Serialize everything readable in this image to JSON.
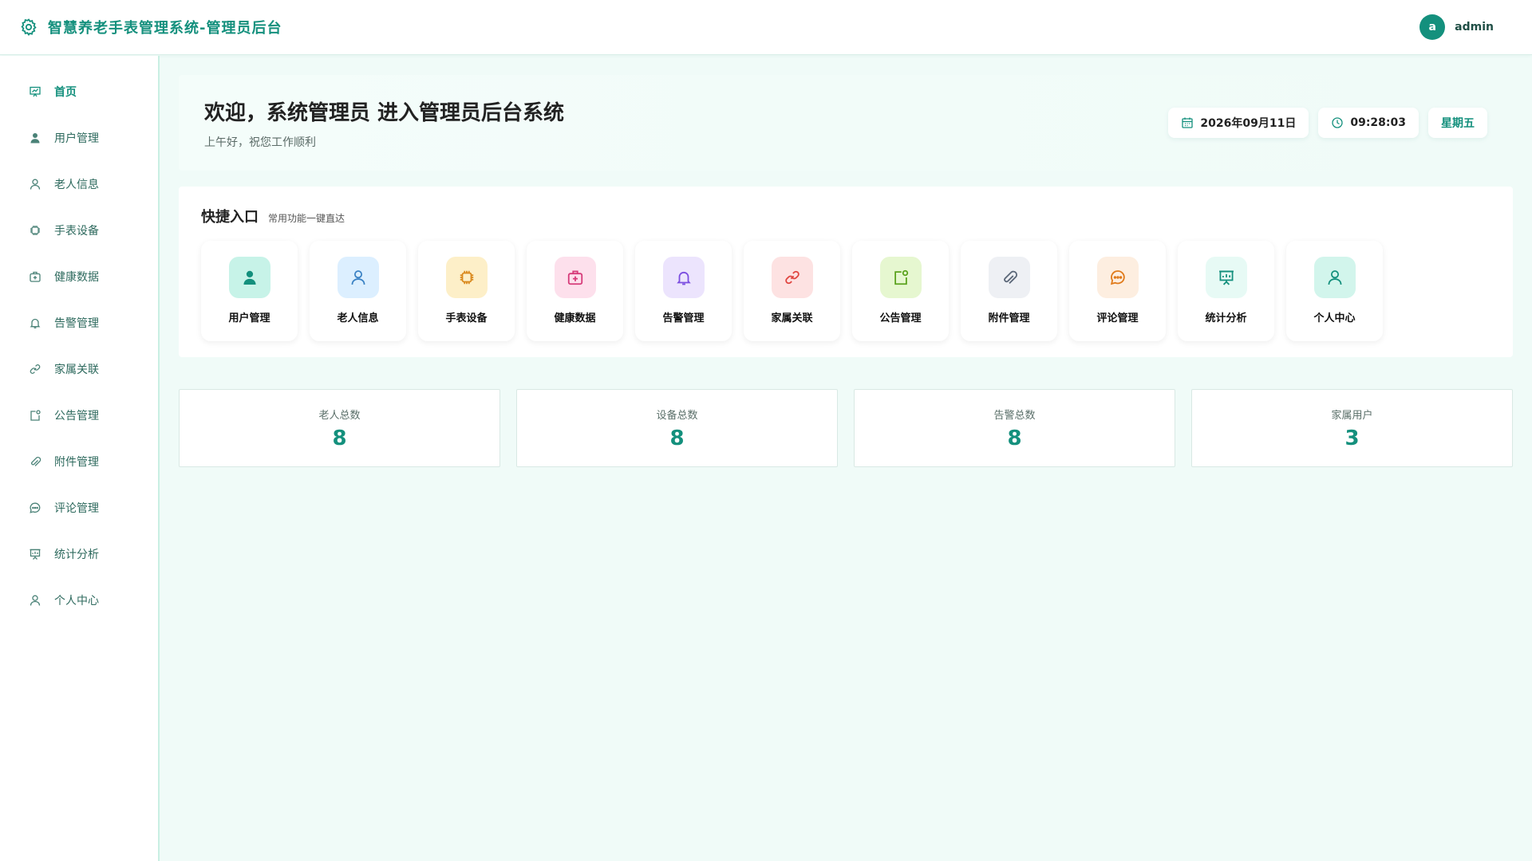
{
  "app": {
    "title": "智慧养老手表管理系统-管理员后台"
  },
  "user": {
    "avatar_letter": "a",
    "name": "admin"
  },
  "sidebar": {
    "items": [
      {
        "label": "首页",
        "icon": "chart-board-icon",
        "active": true
      },
      {
        "label": "用户管理",
        "icon": "user-filled-icon"
      },
      {
        "label": "老人信息",
        "icon": "user-icon"
      },
      {
        "label": "手表设备",
        "icon": "cpu-icon"
      },
      {
        "label": "健康数据",
        "icon": "first-aid-kit-icon"
      },
      {
        "label": "告警管理",
        "icon": "bell-icon"
      },
      {
        "label": "家属关联",
        "icon": "link-icon"
      },
      {
        "label": "公告管理",
        "icon": "notification-icon"
      },
      {
        "label": "附件管理",
        "icon": "paperclip-icon"
      },
      {
        "label": "评论管理",
        "icon": "chat-icon"
      },
      {
        "label": "统计分析",
        "icon": "presentation-icon"
      },
      {
        "label": "个人中心",
        "icon": "user-icon"
      }
    ]
  },
  "welcome": {
    "title": "欢迎，系统管理员 进入管理员后台系统",
    "subtitle": "上午好，祝您工作顺利",
    "date": "2026年09月11日",
    "time": "09:28:03",
    "weekday": "星期五"
  },
  "quick": {
    "title": "快捷入口",
    "subtitle": "常用功能一键直达",
    "items": [
      {
        "label": "用户管理",
        "icon": "user-filled-icon",
        "bg": "#c7f3e8",
        "fg": "#14907d"
      },
      {
        "label": "老人信息",
        "icon": "user-icon",
        "bg": "#dcefff",
        "fg": "#3b82c4"
      },
      {
        "label": "手表设备",
        "icon": "cpu-icon",
        "bg": "#fdefc8",
        "fg": "#d9881b"
      },
      {
        "label": "健康数据",
        "icon": "first-aid-kit-icon",
        "bg": "#fde0ec",
        "fg": "#d63a79"
      },
      {
        "label": "告警管理",
        "icon": "bell-icon",
        "bg": "#ece4fd",
        "fg": "#7c4ee0"
      },
      {
        "label": "家属关联",
        "icon": "link-icon",
        "bg": "#fde2e2",
        "fg": "#e0443f"
      },
      {
        "label": "公告管理",
        "icon": "notification-icon",
        "bg": "#e6f7d0",
        "fg": "#5aa21d"
      },
      {
        "label": "附件管理",
        "icon": "paperclip-icon",
        "bg": "#eef0f4",
        "fg": "#5b6778"
      },
      {
        "label": "评论管理",
        "icon": "chat-icon",
        "bg": "#fdeee0",
        "fg": "#e07a1a"
      },
      {
        "label": "统计分析",
        "icon": "presentation-icon",
        "bg": "#e7faf5",
        "fg": "#14907d"
      },
      {
        "label": "个人中心",
        "icon": "user-icon",
        "bg": "#d2f5ec",
        "fg": "#14907d"
      }
    ]
  },
  "stats": [
    {
      "label": "老人总数",
      "value": "8"
    },
    {
      "label": "设备总数",
      "value": "8"
    },
    {
      "label": "告警总数",
      "value": "8"
    },
    {
      "label": "家属用户",
      "value": "3"
    }
  ],
  "colors": {
    "accent": "#14907d",
    "background": "#f0fbf8"
  }
}
